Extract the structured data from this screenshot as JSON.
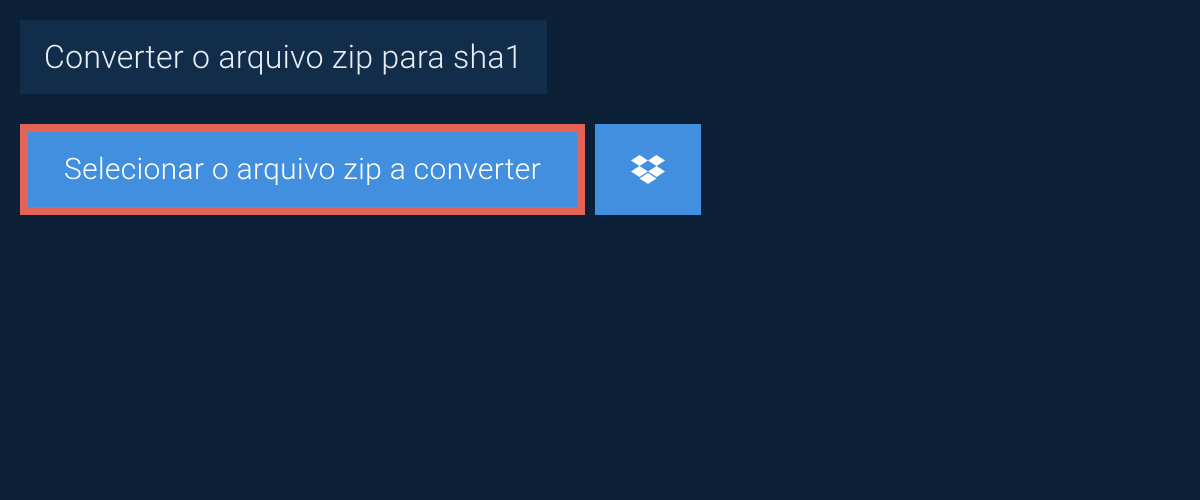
{
  "header": {
    "title": "Converter o arquivo zip para sha1"
  },
  "actions": {
    "select_file_label": "Selecionar o arquivo zip a converter",
    "dropbox_icon_name": "dropbox-icon"
  },
  "colors": {
    "page_bg": "#0c2138",
    "panel_bg": "#112d4a",
    "button_blue": "#418fde",
    "highlight_red": "#e36457",
    "text_light": "#e8eef5",
    "text_white": "#ffffff"
  }
}
